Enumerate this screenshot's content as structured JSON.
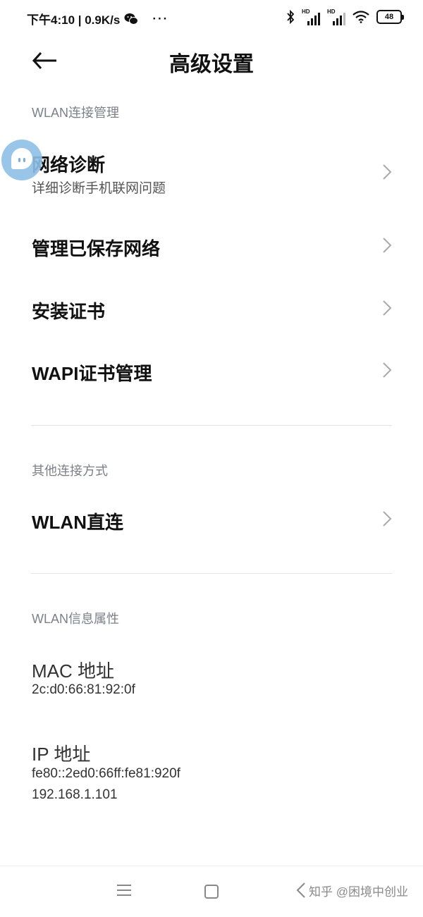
{
  "status_bar": {
    "time_speed": "下午4:10 | 0.9K/s",
    "more": "···",
    "sim1_label": "HD",
    "sim2_label": "HD",
    "battery": "48",
    "icons": [
      "wechat-icon",
      "bluetooth-icon",
      "signal-icon",
      "wifi-icon",
      "battery-icon"
    ]
  },
  "header": {
    "title": "高级设置",
    "back_icon": "arrow-left-icon"
  },
  "sections": {
    "wlan_manage": "WLAN连接管理",
    "other_connect": "其他连接方式",
    "wlan_info": "WLAN信息属性"
  },
  "rows": {
    "diagnosis": {
      "title": "网络诊断",
      "subtitle": "详细诊断手机联网问题"
    },
    "saved_networks": {
      "title": "管理已保存网络"
    },
    "install_cert": {
      "title": "安装证书"
    },
    "wapi_cert": {
      "title": "WAPI证书管理"
    },
    "wlan_direct": {
      "title": "WLAN直连"
    }
  },
  "info": {
    "mac": {
      "title": "MAC 地址",
      "value": "2c:d0:66:81:92:0f"
    },
    "ip": {
      "title": "IP 地址",
      "value_v6": "fe80::2ed0:66ff:fe81:920f",
      "value_v4": "192.168.1.101"
    }
  },
  "nav": {
    "watermark": "知乎 @困境中创业"
  },
  "colors": {
    "section_label": "#7c8088",
    "bubble": "#8fc0e6",
    "divider": "#e4e4e4"
  }
}
